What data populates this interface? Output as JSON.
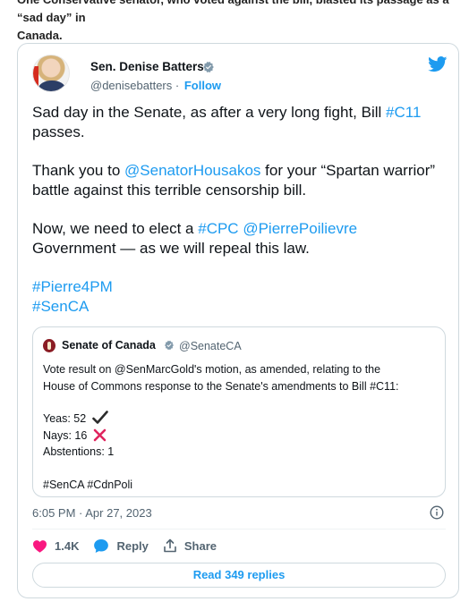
{
  "article": {
    "caption_line1": "One Conservative senator, who voted against the bill, blasted its passage as a “sad day” in",
    "caption_line2": "Canada."
  },
  "tweet": {
    "author_name": "Sen. Denise Batters",
    "handle": "@denisebatters",
    "separator": "·",
    "follow_label": "Follow",
    "brand_color": "#1d9bf0",
    "body": {
      "p1_pre": "Sad day in the Senate, as after a very long fight, Bill ",
      "p1_tag": "#C11",
      "p1_post": " passes.",
      "p2_pre": "Thank you to ",
      "p2_mention": "@SenatorHousakos",
      "p2_post": " for your “Spartan warrior” battle against this terrible censorship bill.",
      "p3_pre": "Now, we need to elect a ",
      "p3_tag": "#CPC",
      "p3_mid": " ",
      "p3_mention": "@PierrePoilievre",
      "p3_post": " Government — as we will repeal this law.",
      "tag_pierre": "#Pierre4PM",
      "tag_senca": "#SenCA"
    },
    "quote": {
      "author_name": "Senate of Canada",
      "handle": "@SenateCA",
      "line1": "Vote result on @SenMarcGold's motion, as amended, relating to the",
      "line2": "House of Commons response to the Senate's amendments to Bill #C11:",
      "yeas": "Yeas: 52",
      "nays": "Nays: 16",
      "abstentions": "Abstentions: 1",
      "tags": "#SenCA #CdnPoli"
    },
    "timestamp": "6:05 PM · Apr 27, 2023",
    "actions": {
      "likes": "1.4K",
      "reply_label": "Reply",
      "share_label": "Share"
    },
    "read_replies_label": "Read 349 replies",
    "icons": [
      "verified-icon",
      "twitter-bird-icon",
      "info-icon",
      "heart-icon",
      "reply-bubble-icon",
      "share-icon",
      "check-mark-icon",
      "cross-mark-icon"
    ]
  }
}
